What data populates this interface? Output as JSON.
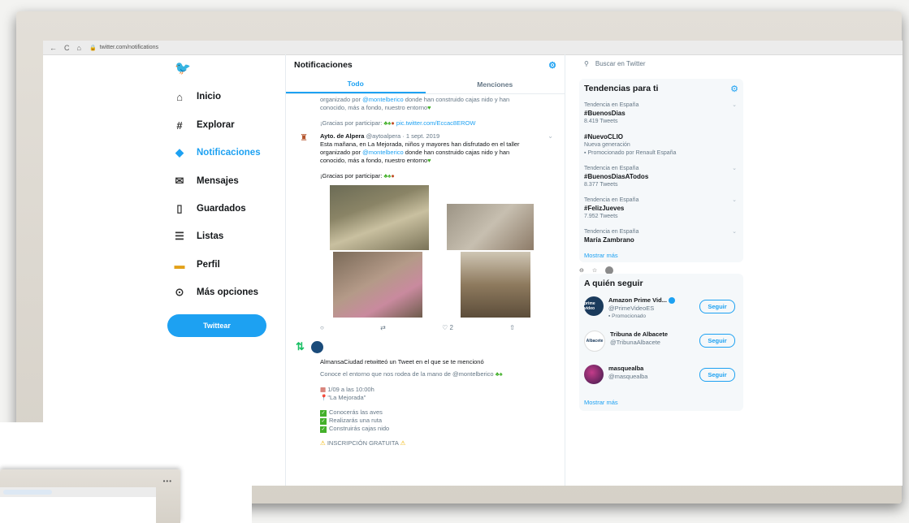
{
  "browser": {
    "url": "twitter.com/notifications"
  },
  "sidebar": {
    "items": [
      {
        "label": "Inicio",
        "icon": "home-icon",
        "glyph": "⌂"
      },
      {
        "label": "Explorar",
        "icon": "hashtag-icon",
        "glyph": "#"
      },
      {
        "label": "Notificaciones",
        "icon": "bell-icon",
        "glyph": "🔔"
      },
      {
        "label": "Mensajes",
        "icon": "envelope-icon",
        "glyph": "✉"
      },
      {
        "label": "Guardados",
        "icon": "bookmark-icon",
        "glyph": "⊐"
      },
      {
        "label": "Listas",
        "icon": "list-icon",
        "glyph": "☰"
      },
      {
        "label": "Perfil",
        "icon": "profile-icon",
        "glyph": "•"
      },
      {
        "label": "Más opciones",
        "icon": "more-icon",
        "glyph": "⋯"
      }
    ],
    "tweet_button": "Twittear"
  },
  "main": {
    "title": "Notificaciones",
    "tabs": [
      "Todo",
      "Menciones"
    ],
    "prev_tweet": {
      "line1": "organizado por",
      "link": "@montelberico",
      "line1b": "donde han construido cajas nido y han",
      "line2": "conocido, más a fondo, nuestro entorno",
      "thanks": "¡Gracias por participar",
      "pic": "pic.twitter.com/Eccac8EROW"
    },
    "tweet": {
      "name": "Ayto. de Alpera",
      "handle": "@aytoalpera · 1 sept. 2019",
      "line1": "Esta mañana, en La Mejorada, niños y mayores han disfrutado en el taller",
      "line2a": "organizado por",
      "link": "@montelberico",
      "line2b": "donde han construido cajas nido y han",
      "line3": "conocido, más a fondo, nuestro entorno",
      "thanks": "¡Gracias por participar",
      "likes": "2"
    },
    "retweet": {
      "text": "AlmansaCiudad retwitteó un Tweet en el que se te mencionó",
      "body": "Conoce el entorno que nos rodea de la mano de @montelberico",
      "date": "1/09 a las 10:00h",
      "place": "\"La Mejorada\"",
      "checks": [
        "Conocerás las aves",
        "Realizarás una ruta",
        "Construirás cajas nido"
      ],
      "footer": "INSCRIPCIÓN GRATUITA"
    }
  },
  "right": {
    "search_placeholder": "Buscar en Twitter",
    "trends_title": "Tendencias para ti",
    "trends": [
      {
        "context": "Tendencia en España",
        "topic": "#BuenosDias",
        "count": "8.419 Tweets"
      },
      {
        "context": "",
        "topic": "#NuevoCLIO",
        "count": "Nueva generación",
        "promoted": "Promocionado por Renault España"
      },
      {
        "context": "Tendencia en España",
        "topic": "#BuenosDiasATodos",
        "count": "8.377 Tweets"
      },
      {
        "context": "Tendencia en España",
        "topic": "#FelizJueves",
        "count": "7.952 Tweets"
      },
      {
        "context": "Tendencia en España",
        "topic": "María Zambrano",
        "count": ""
      }
    ],
    "show_more": "Mostrar más",
    "follow_title": "A quién seguir",
    "follow": [
      {
        "name": "Amazon Prime Vid...",
        "handle": "@PrimeVideoES",
        "promoted": "Promocionado",
        "button": "Seguir",
        "color": "#1a3a5c",
        "avatar_text": "prime video"
      },
      {
        "name": "Tribuna de Albacete",
        "handle": "@TribunaAlbacete",
        "promoted": "",
        "button": "Seguir",
        "color": "#ffffff",
        "avatar_text": "Albacete"
      },
      {
        "name": "masquealba",
        "handle": "@masquealba",
        "promoted": "",
        "button": "Seguir",
        "color": "#7a1a6a",
        "avatar_text": ""
      }
    ],
    "follow_more": "Mostrar más"
  },
  "colors": {
    "accent": "#1da1f2",
    "retweet": "#17bf63"
  }
}
